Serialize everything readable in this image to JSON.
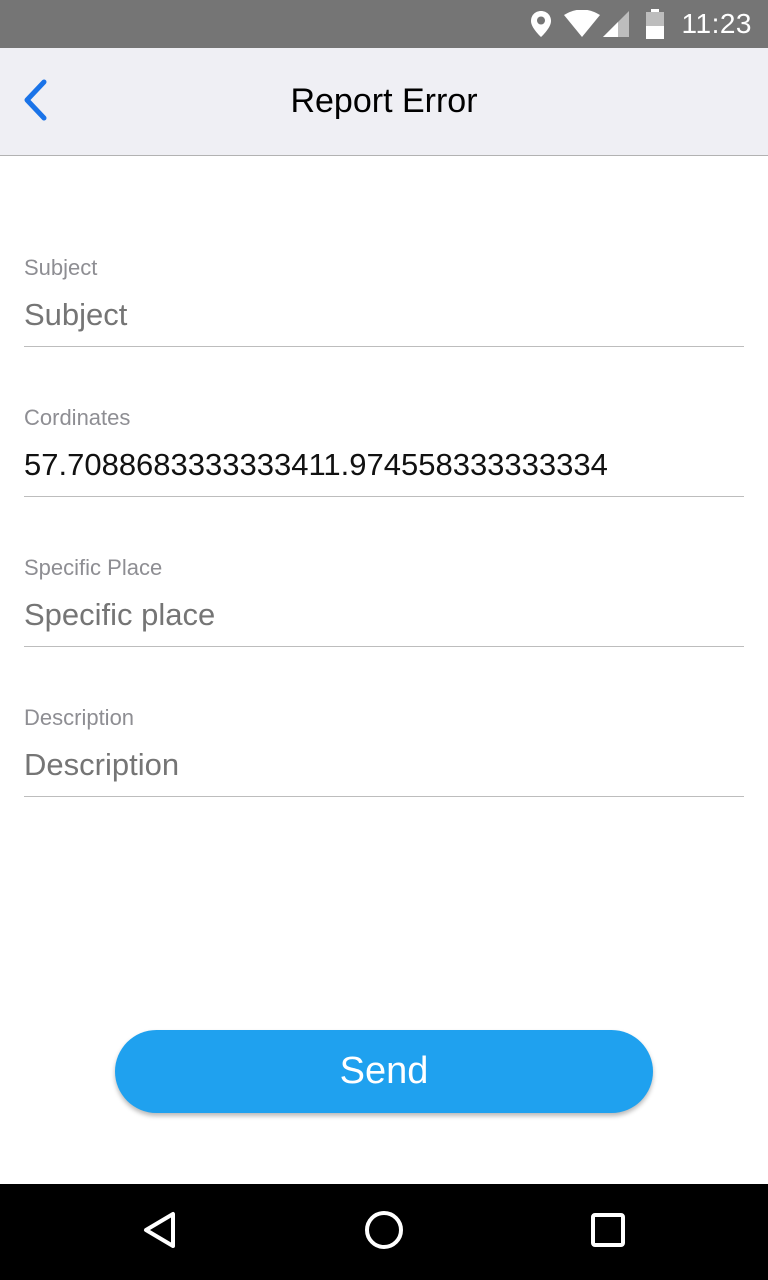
{
  "status_bar": {
    "time": "11:23",
    "background": "#757575",
    "icons": [
      "location-icon",
      "wifi-icon",
      "signal-icon",
      "battery-icon"
    ]
  },
  "app_bar": {
    "title": "Report Error",
    "back_icon": "chevron-left-icon",
    "accent": "#1a73e8",
    "background": "#efeff4"
  },
  "form": {
    "subject": {
      "label": "Subject",
      "placeholder": "Subject",
      "value": ""
    },
    "coordinates": {
      "label": "Cordinates",
      "placeholder": "",
      "value": "57.7088683333333411.974558333333334"
    },
    "specific_place": {
      "label": "Specific Place",
      "placeholder": "Specific place",
      "value": ""
    },
    "description": {
      "label": "Description",
      "placeholder": "Description",
      "value": ""
    }
  },
  "send_button": {
    "label": "Send",
    "color": "#1fa1ef"
  },
  "nav_bar": {
    "icons": [
      "back-triangle-icon",
      "home-circle-icon",
      "recents-square-icon"
    ]
  }
}
